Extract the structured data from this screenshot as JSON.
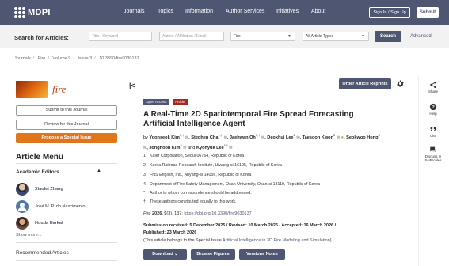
{
  "topnav": {
    "logo": "MDPI",
    "links": [
      "Journals",
      "Topics",
      "Information",
      "Author Services",
      "Initiatives",
      "About"
    ],
    "sign_in": "Sign In / Sign Up",
    "submit": "Submit"
  },
  "search": {
    "label": "Search for Articles:",
    "title_placeholder": "Title / Keyword",
    "author_placeholder": "Author / Affiliation / Email",
    "journal_value": "Fire",
    "type_value": "All Article Types",
    "search_button": "Search",
    "advanced": "Advanced"
  },
  "breadcrumb": [
    "Journals",
    "Fire",
    "Volume 9",
    "Issue 3",
    "10.3390/fire9030137"
  ],
  "sidebar": {
    "journal_name": "fire",
    "submit_to_journal": "Submit to this Journal",
    "review_for_journal": "Review for this Journal",
    "propose_special_issue": "Propose a Special Issue",
    "article_menu": "Article Menu",
    "academic_editors": "Academic Editors",
    "editors": [
      {
        "name": "Xiaolei Zhang"
      },
      {
        "name": "José M. P. do Nascimento"
      },
      {
        "name": "Houda Harkat"
      }
    ],
    "show_more": "Show more...",
    "recommended_articles": "Recommended Articles"
  },
  "article": {
    "reprints_button": "Order Article Reprints",
    "badge_open_access": "Open Access",
    "badge_type": "Article",
    "title": "A Real-Time 2D Spatiotemporal Fire Spread Forecasting Artificial Intelligence Agent",
    "authors_prefix": "by",
    "authors": [
      {
        "name": "Yoonseok Kim",
        "sup": "1,†"
      },
      {
        "name": "Stephen Cha",
        "sup": "1,†"
      },
      {
        "name": "Jaehwan Oh",
        "sup": "1,†"
      },
      {
        "name": "Deokhui Lee",
        "sup": "2"
      },
      {
        "name": "Taesoon Kwon",
        "sup": "2"
      },
      {
        "name": "Seokwoo Hong",
        "sup": "3"
      },
      {
        "name": "Jonghoon Kim",
        "sup": "4"
      },
      {
        "name": "Kyohyuk Lee",
        "sup": "1,*"
      }
    ],
    "affiliations": [
      {
        "num": "1",
        "text": "Kaier Corporation, Seoul 06764, Republic of Korea"
      },
      {
        "num": "2",
        "text": "Korea Railroad Research Institute, Uiwang-si 16105, Republic of Korea"
      },
      {
        "num": "3",
        "text": "FNS English, Inc., Anyang-si 14056, Republic of Korea"
      },
      {
        "num": "4",
        "text": "Department of Fire Safety Management, Osan University, Osan-si 18119, Republic of Korea"
      },
      {
        "num": "*",
        "text": "Author to whom correspondence should be addressed."
      },
      {
        "num": "†",
        "text": "These authors contributed equally to this work."
      }
    ],
    "citation_journal": "Fire",
    "citation_year_vol": "2026, 9",
    "citation_rest": "(3), 137;",
    "doi": "https://doi.org/10.3390/fire9030137",
    "dates_line1": "Submission received: 5 December 2025 / Revised: 10 March 2026 / Accepted: 16 March 2026 /",
    "dates_line2": "Published: 23 March 2026",
    "special_prefix": "(This article belongs to the Special Issue ",
    "special_link": "Artificial Intelligence in 3D Fire Modeling and Simulation",
    "special_suffix": ")",
    "download": "Download",
    "browse_figures": "Browse Figures",
    "versions_notes": "Versions Notes"
  },
  "rail": {
    "share": "Share",
    "help": "Help",
    "cite": "Cite",
    "discuss": "Discuss in SciProfiles"
  },
  "colors": {
    "nav_bg": "#4f5671",
    "accent_orange": "#e0751a",
    "article_badge": "#a52a22"
  }
}
